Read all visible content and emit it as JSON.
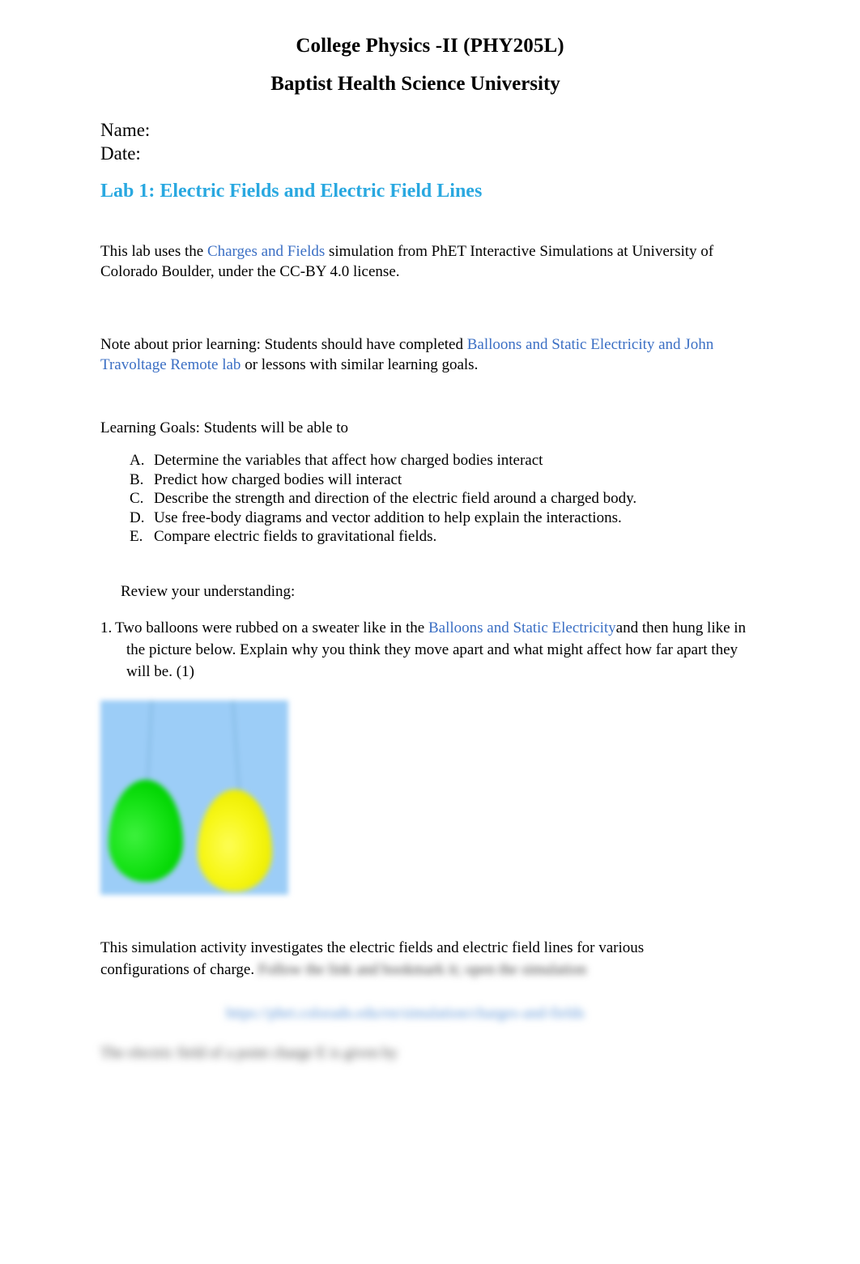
{
  "header": {
    "course_title": "College Physics -II (PHY205L)",
    "institution": "Baptist Health Science University"
  },
  "meta": {
    "name_label": "Name:",
    "date_label": "Date:"
  },
  "lab": {
    "heading": "Lab 1: Electric Fields and Electric Field Lines",
    "heading_color": "#29a8e0",
    "link_color": "#3b6fc4"
  },
  "attribution": {
    "before_link": "This lab uses the ",
    "link_text": "Charges and Fields",
    "after_link": " simulation from PhET Interactive Simulations at University of Colorado Boulder, under the CC-BY 4.0 license."
  },
  "prior_learning": {
    "before_link": "Note about prior learning:  Students should have completed  ",
    "link_text": "Balloons and Static Electricity and John Travoltage Remote lab",
    "after_link": " or lessons with similar learning goals."
  },
  "learning_goals": {
    "intro": "Learning Goals: Students will be able to",
    "items": [
      {
        "marker": "A.",
        "text": "Determine the variables that affect how charged bodies interact"
      },
      {
        "marker": "B.",
        "text": "Predict how charged bodies will interact"
      },
      {
        "marker": "C.",
        "text": "Describe the strength and direction of the electric field around a charged body."
      },
      {
        "marker": "D.",
        "text": "Use free-body diagrams and vector addition to help explain the interactions."
      },
      {
        "marker": "E.",
        "text": "Compare electric fields to gravitational fields."
      }
    ]
  },
  "review": {
    "section_label": "Review your understanding:",
    "question_number": "1.",
    "q1_part1": "Two balloons were rubbed on a sweater like in the  ",
    "q1_link": "Balloons and Static Electricity",
    "q1_part2": "and then hung like in",
    "q1_part3": "the picture below. Explain why you think they move apart and what might affect how far apart they",
    "q1_part4": "will be.  (1)"
  },
  "figure": {
    "caption": "two-balloons-hanging-photo",
    "sky_color": "#9ccdf7",
    "balloon_left_color": "#16e316",
    "balloon_right_color": "#f7f718"
  },
  "closing": {
    "sim_text_line1": "This simulation activity investigates the electric fields and electric field lines for various",
    "sim_text_line2": "configurations of charge. ",
    "redacted_inline": "Follow the link and bookmark it; open the simulation",
    "redacted_link": "https://phet.colorado.edu/en/simulation/charges-and-fields",
    "redacted_tail": "The electric field of a point charge  E   is given by"
  }
}
